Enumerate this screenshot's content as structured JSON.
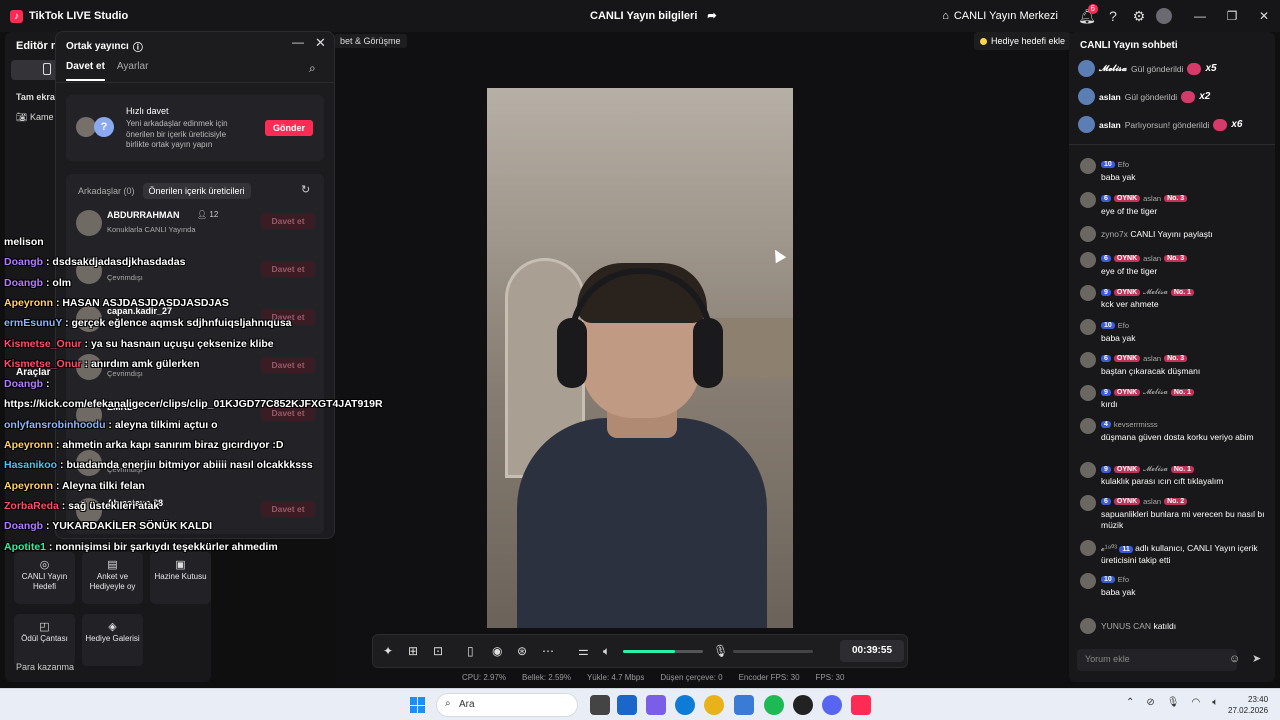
{
  "titlebar": {
    "app_title": "TikTok LIVE Studio",
    "center_title": "CANLI Yayın bilgileri",
    "live_center": "CANLI Yayın Merkezi",
    "notif_count": "6"
  },
  "editor": {
    "title": "Editör m",
    "fullscreen_label": "Tam ekra",
    "camera_label": "Kame",
    "tools_title": "Araçlar",
    "tools": [
      {
        "label": "CANLI Yayın Hedefi"
      },
      {
        "label": "Anket ve Hediyeyle oy"
      },
      {
        "label": "Hazine Kutusu"
      },
      {
        "label": "Ödül Çantası"
      },
      {
        "label": "Hediye Galerisi"
      }
    ],
    "para_kazanma": "Para kazanma"
  },
  "cohost": {
    "title": "Ortak yayıncı",
    "tabs": [
      "Davet et",
      "Ayarlar"
    ],
    "quick": {
      "title": "Hızlı davet",
      "desc": "Yeni arkadaşlar edinmek için önerilen bir içerik üreticisiyle birlikte ortak yayın yapın",
      "send": "Gönder",
      "avatar_q": "?"
    },
    "list_tabs": [
      "Arkadaşlar (0)",
      "Önerilen içerik üreticileri"
    ],
    "users": [
      {
        "name": "ABDURRAHMAN",
        "status": "Konuklarla CANLI Yayında",
        "count": "12",
        "btn": "Davet et"
      },
      {
        "name": "",
        "status": "Çevrimdışı",
        "count": "",
        "btn": "Davet et"
      },
      {
        "name": "capan.kadir_27",
        "status": "",
        "count": "",
        "btn": "Davet et"
      },
      {
        "name": "",
        "status": "Çevrimdışı",
        "count": "",
        "btn": "Davet et"
      },
      {
        "name": "EMRE",
        "status": "",
        "count": "",
        "btn": "Davet et"
      },
      {
        "name": "",
        "status": "Çevrimdışı",
        "count": "",
        "btn": ""
      },
      {
        "name": "Ahmetayo.38",
        "status": "",
        "count": "",
        "btn": "Davet et"
      }
    ]
  },
  "stage": {
    "gorusme": "bet & Görüşme",
    "gift_goal": "Hediye hedefi ekle",
    "timer": "00:39:55",
    "volume": 0.65,
    "stats": [
      "CPU: 2.97%",
      "Bellek: 2.59%",
      "Yükle: 4.7 Mbps",
      "Düşen çerçeve: 0",
      "Encoder FPS: 30",
      "FPS: 30"
    ]
  },
  "overlay_chat": [
    {
      "user": "melison",
      "color": "#ffffff",
      "text": ""
    },
    {
      "user": "Doangb",
      "color": "#b57bff",
      "text": ": dsdsakdjadasdjkhasdadas"
    },
    {
      "user": "Doangb",
      "color": "#b57bff",
      "text": ": olm"
    },
    {
      "user": "Apeyronn",
      "color": "#ffd166",
      "text": ": HASAN ASJDASJDASDJASDJAS"
    },
    {
      "user": "ermEsunuY",
      "color": "#8fb3ff",
      "text": ": gerçek eğlence aqmsk sdjhnfuiqsljahnıqusa"
    },
    {
      "user": "Kismetse_Onur",
      "color": "#ff4d6d",
      "text": ": ya su hasnaın uçuşu çeksenize klibe"
    },
    {
      "user": "Kismetse_Onur",
      "color": "#ff4d6d",
      "text": ": anırdım amk gülerken"
    },
    {
      "user": "Doangb",
      "color": "#b57bff",
      "text": ":"
    },
    {
      "user": "",
      "color": "#ffffff",
      "text": "https://kick.com/efekanaligecer/clips/clip_01KJGD77C852KJFXGT4JAT919R"
    },
    {
      "user": "onlyfansrobinhoodu",
      "color": "#8fb3ff",
      "text": ": aleyna tilkimi açtuı o"
    },
    {
      "user": "Apeyronn",
      "color": "#ffd166",
      "text": ": ahmetin arka kapı sanırım biraz gıcırdıyor :D"
    },
    {
      "user": "Hasanikoo",
      "color": "#4fc3f7",
      "text": ": buadamda enerjiıı bitmiyor abiiii nasıl olcakkksss"
    },
    {
      "user": "Apeyronn",
      "color": "#ffd166",
      "text": ": Aleyna tilki felan"
    },
    {
      "user": "ZorbaReda",
      "color": "#ff4d6d",
      "text": ": sağ üstekileri atak"
    },
    {
      "user": "Doangb",
      "color": "#b57bff",
      "text": ": YUKARDAKİLER SÖNÜK KALDI"
    },
    {
      "user": "Apotite1",
      "color": "#25f4a4",
      "text": ": nonnişimsi bir şarkıydı teşekkürler ahmedim"
    }
  ],
  "chat": {
    "title": "CANLI Yayın sohbeti",
    "gifts": [
      {
        "user": "𝓜𝓮𝓵𝓲𝓼𝓪",
        "text": "Gül gönderildi",
        "mult": "x5"
      },
      {
        "user": "aslan",
        "text": "Gül gönderildi",
        "mult": "x2"
      },
      {
        "user": "aslan",
        "text": "Parlıyorsun! gönderildi",
        "mult": "x6"
      }
    ],
    "messages": [
      {
        "lvl": "10",
        "fan": "",
        "user": "Efo",
        "rank": "",
        "text": "baba yak"
      },
      {
        "lvl": "6",
        "fan": "OYNK",
        "user": "aslan",
        "rank": "No. 3",
        "text": "eye of the tiger"
      },
      {
        "lvl": "6",
        "fan": "OYNK",
        "user": "aslan",
        "rank": "No. 3",
        "text": "eye of the tiger"
      },
      {
        "lvl": "9",
        "fan": "OYNK",
        "user": "𝓜𝓮𝓵𝓲𝓼𝓪",
        "rank": "No. 1",
        "text": "kck ver ahmete"
      },
      {
        "lvl": "10",
        "fan": "",
        "user": "Efo",
        "rank": "",
        "text": "baba yak"
      },
      {
        "lvl": "6",
        "fan": "OYNK",
        "user": "aslan",
        "rank": "No. 3",
        "text": "baştan çıkaracak düşmanı"
      },
      {
        "lvl": "9",
        "fan": "OYNK",
        "user": "𝓜𝓮𝓵𝓲𝓼𝓪",
        "rank": "No. 1",
        "text": "kırdı"
      },
      {
        "lvl": "4",
        "fan": "",
        "user": "kevserrmisss",
        "rank": "",
        "text": "düşmana güven dosta korku veriyo abim"
      },
      {
        "lvl": "9",
        "fan": "OYNK",
        "user": "𝓜𝓮𝓵𝓲𝓼𝓪",
        "rank": "No. 1",
        "text": "kulaklık parası ıcın cıft tıklayalım"
      },
      {
        "lvl": "6",
        "fan": "OYNK",
        "user": "aslan",
        "rank": "No. 2",
        "text": "sapuanlikleri bunlara mi verecen bu nasıl bı müzik"
      },
      {
        "lvl": "10",
        "fan": "",
        "user": "Efo",
        "rank": "",
        "text": "baba yak"
      }
    ],
    "share": {
      "user": "zyno7x",
      "text": "CANLI Yayını paylaştı"
    },
    "follow": {
      "user": "𝓮¹⁹⁰³",
      "lvl": "11",
      "text": "adlı kullanıcı, CANLI Yayın içerik üreticisini takip etti"
    },
    "join": {
      "user": "YUNUS CAN",
      "text": "katıldı"
    },
    "comment_placeholder": "Yorum ekle"
  },
  "taskbar": {
    "search": "Ara",
    "time": "23:40",
    "date": "27.02.2026"
  }
}
